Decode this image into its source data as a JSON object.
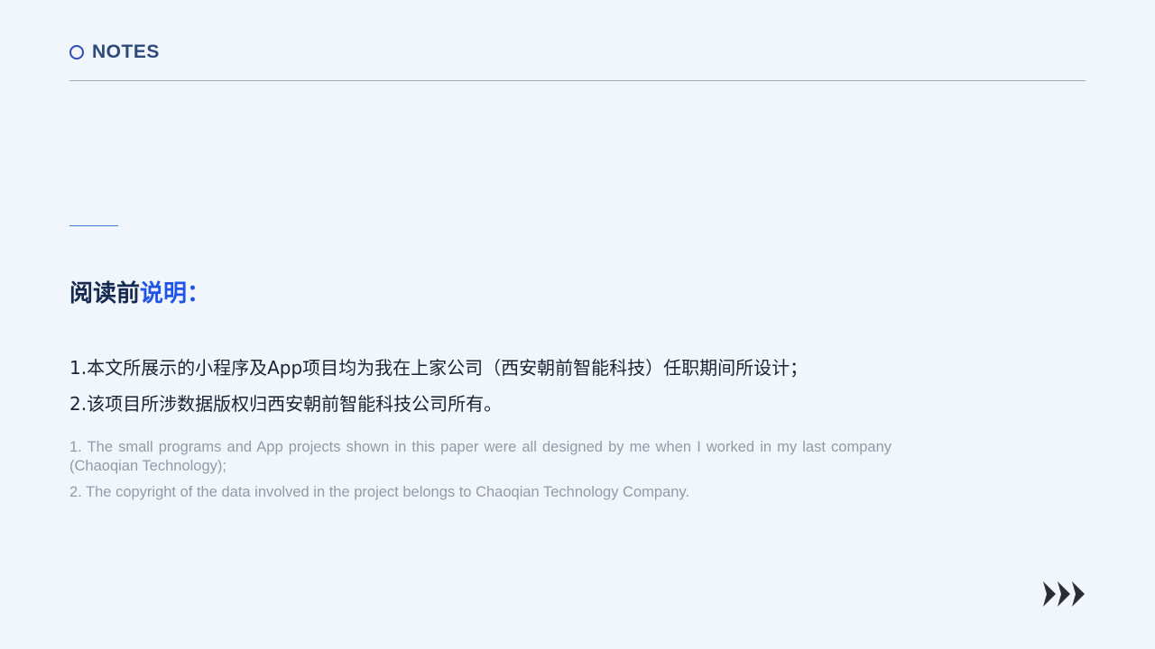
{
  "header": {
    "title": "NOTES",
    "icon": "circle-outline-icon"
  },
  "heading": {
    "dark": "阅读前",
    "accent": "说明："
  },
  "zh_notes": [
    "1.本文所展示的小程序及App项目均为我在上家公司（西安朝前智能科技）任职期间所设计；",
    "2.该项目所涉数据版权归西安朝前智能科技公司所有。"
  ],
  "en_notes": [
    "1. The small programs and App projects shown in this paper were all designed by me when I worked in my last company (Chaoqian Technology);",
    "2. The copyright of the data involved in the project belongs to Chaoqian Technology Company."
  ],
  "footer": {
    "icon": "triple-arrow-right-icon"
  },
  "colors": {
    "background": "#f1f6fd",
    "title": "#2d4a7a",
    "heading_dark": "#16294f",
    "heading_accent": "#1f54e6",
    "body_text": "#1b2233",
    "english_text": "#939aa6",
    "rule": "#a3a7ad",
    "accent_rule": "#3a7bd0"
  }
}
